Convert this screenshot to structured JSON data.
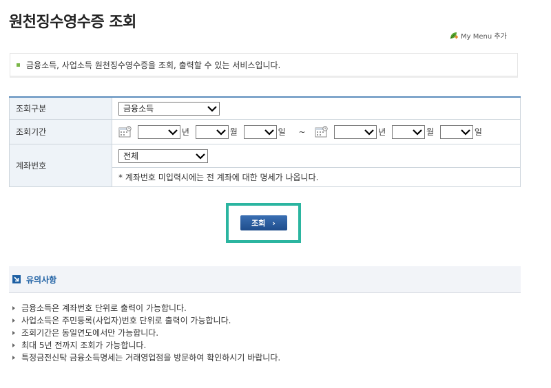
{
  "page": {
    "title": "원천징수영수증 조회",
    "my_menu_label": "My Menu 추가"
  },
  "notice": {
    "text": "금융소득, 사업소득 원천징수영수증을 조회, 출력할 수 있는 서비스입니다."
  },
  "form": {
    "inquiry_type": {
      "label": "조회구분",
      "selected": "금융소득"
    },
    "period": {
      "label": "조회기간",
      "start_year": "",
      "start_year_unit": "년",
      "start_month": "",
      "start_month_unit": "월",
      "start_day": "",
      "start_day_unit": "일",
      "separator": "~",
      "end_year": "",
      "end_year_unit": "년",
      "end_month": "",
      "end_month_unit": "월",
      "end_day": "",
      "end_day_unit": "일"
    },
    "account": {
      "label": "계좌번호",
      "selected": "전체",
      "note": "* 계좌번호 미입력시에는 전 계좌에 대한 명세가 나옵니다."
    }
  },
  "search_button": {
    "label": "조회",
    "arrow": "›"
  },
  "caution": {
    "title": "유의사항",
    "items": [
      "금융소득은 계좌번호 단위로 출력이 가능합니다.",
      "사업소득은 주민등록(사업자)번호 단위로 출력이 가능합니다.",
      "조회기간은 동일연도에서만 가능합니다.",
      "최대 5년 전까지 조회가 가능합니다.",
      "특정금전신탁 금융소득명세는 거래영업점을 방문하여 확인하시기 바랍니다."
    ]
  },
  "colors": {
    "accent_blue": "#1d5fa3",
    "table_top_border": "#5b8cbc",
    "header_cell_bg": "#eef3f8",
    "highlight_border": "#2bb5a0",
    "notice_bullet": "#7ab648"
  },
  "icons": {
    "my_menu": "leaf-plus-icon",
    "calendar": "calendar-icon",
    "caution": "arrow-box-icon",
    "bullet": "triangle-bullet-icon"
  }
}
